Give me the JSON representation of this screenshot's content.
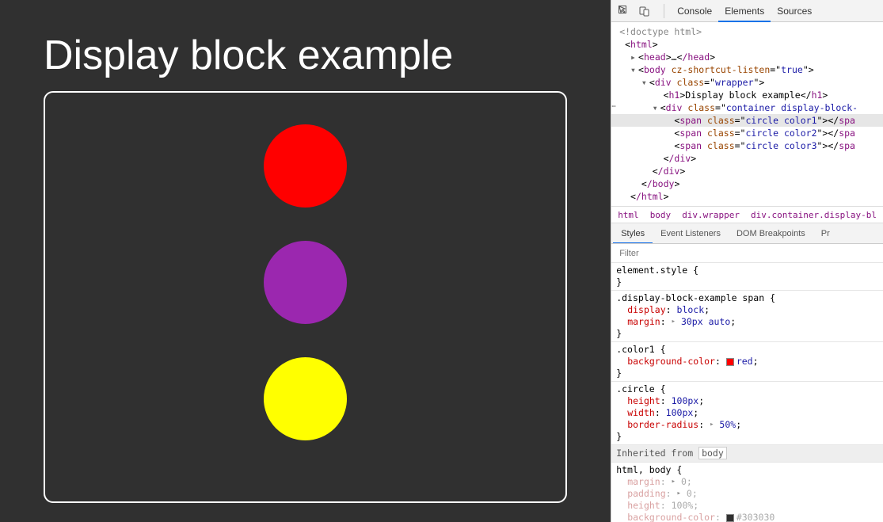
{
  "viewport": {
    "heading": "Display block example"
  },
  "devtools": {
    "top_tabs": {
      "console": "Console",
      "elements": "Elements",
      "sources": "Sources"
    },
    "dom": {
      "doctype": "<!doctype html>",
      "html_open": "html",
      "head_collapsed_open": "head",
      "head_collapsed_ellipsis": "…",
      "head_collapsed_close": "/head",
      "body_tag": "body",
      "body_attr_name": "cz-shortcut-listen",
      "body_attr_val": "true",
      "wrapper_tag": "div",
      "wrapper_class": "wrapper",
      "h1_tag": "h1",
      "h1_text": "Display block example",
      "container_tag": "div",
      "container_class": "container display-block-",
      "span_tag": "span",
      "span1_class": "circle color1",
      "span2_class": "circle color2",
      "span3_class": "circle color3",
      "close_div": "/div",
      "close_body": "/body",
      "close_html": "/html"
    },
    "breadcrumb": [
      "html",
      "body",
      "div.wrapper",
      "div.container.display-bl"
    ],
    "styles_tabs": [
      "Styles",
      "Event Listeners",
      "DOM Breakpoints",
      "Pr"
    ],
    "filter_placeholder": "Filter",
    "rules": {
      "element_style_sel": "element.style",
      "dbe_sel": ".display-block-example span",
      "dbe_p1_name": "display",
      "dbe_p1_val": "block",
      "dbe_p2_name": "margin",
      "dbe_p2_val": "30px auto",
      "color1_sel": ".color1",
      "color1_p_name": "background-color",
      "color1_p_val": "red",
      "circle_sel": ".circle",
      "circle_p1_name": "height",
      "circle_p1_val": "100px",
      "circle_p2_name": "width",
      "circle_p2_val": "100px",
      "circle_p3_name": "border-radius",
      "circle_p3_val": "50%",
      "inherited_label": "Inherited from",
      "inherited_src": "body",
      "htmlbody_sel": "html, body",
      "hb_p1_name": "margin",
      "hb_p1_val": "0",
      "hb_p2_name": "padding",
      "hb_p2_val": "0",
      "hb_p3_name": "height",
      "hb_p3_val": "100%",
      "hb_p4_name": "background-color",
      "hb_p4_val": "#303030"
    }
  }
}
